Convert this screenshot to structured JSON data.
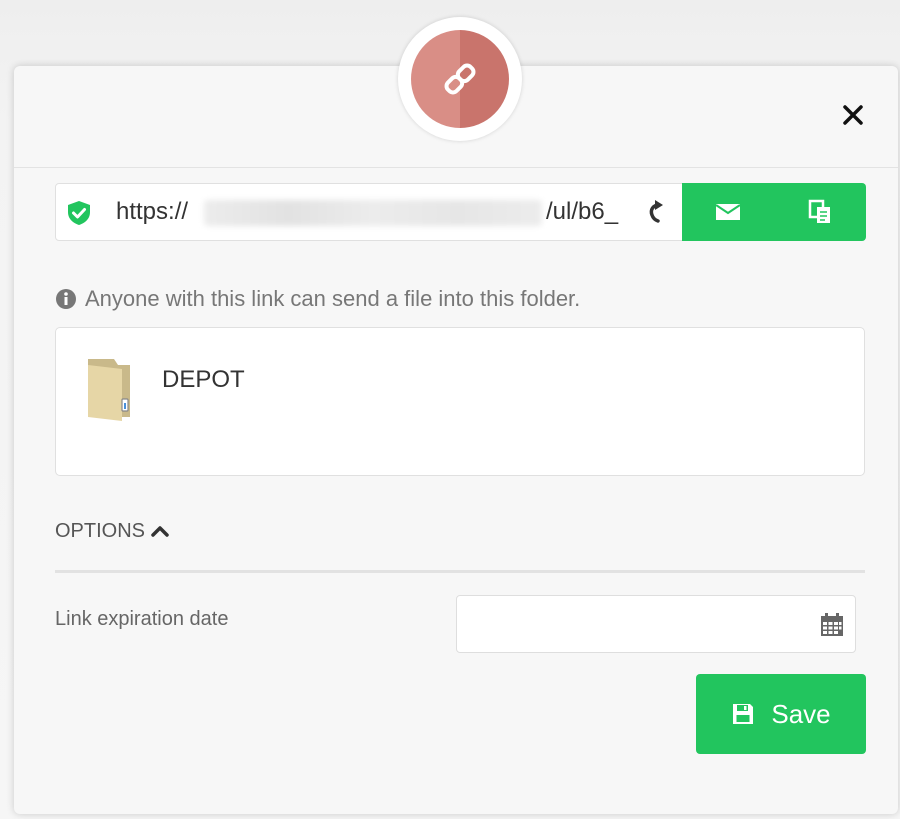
{
  "dialog": {
    "badge_icon": "link-icon",
    "close_icon": "close-icon"
  },
  "link": {
    "url_prefix": "https://",
    "url_suffix": "/ul/b6_",
    "secure_icon": "shield-check-icon",
    "refresh_icon": "refresh-icon",
    "email_icon": "envelope-icon",
    "copy_icon": "copy-icon"
  },
  "info": {
    "text": "Anyone with this link can send a file into this folder."
  },
  "folder": {
    "name": "DEPOT"
  },
  "options": {
    "label": "OPTIONS",
    "expiration_label": "Link expiration date",
    "expiration_value": ""
  },
  "actions": {
    "save_label": "Save"
  },
  "colors": {
    "accent": "#22c55e",
    "badge": "#d98e86"
  }
}
